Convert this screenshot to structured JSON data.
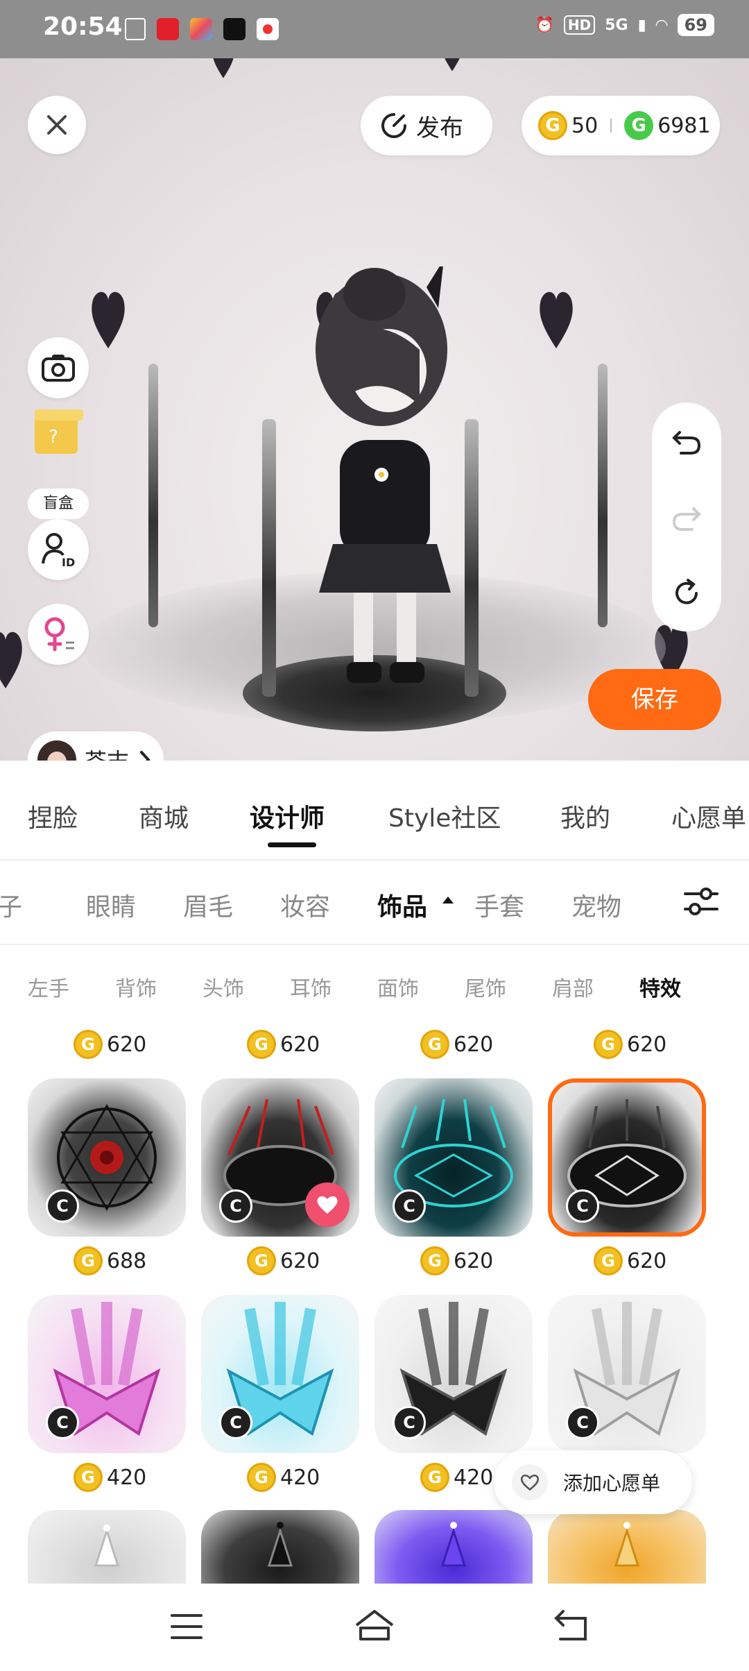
{
  "status_bar": {
    "time": "20:54",
    "hd_label": "HD",
    "network": "5G",
    "battery": "69"
  },
  "scene": {
    "close_icon": "close-icon",
    "publish_label": "发布",
    "coin_gold_amount": "50",
    "coin_green_amount": "6981",
    "blindbox_label": "盲盒",
    "user_name": "芥末",
    "save_label": "保存"
  },
  "tabs": [
    "捏脸",
    "商城",
    "设计师",
    "Style社区",
    "我的",
    "心愿单"
  ],
  "active_tab": "设计师",
  "categories": [
    "鞋子",
    "眼睛",
    "眉毛",
    "妆容",
    "饰品",
    "手套",
    "宠物"
  ],
  "active_category": "饰品",
  "subcategories": [
    "左手",
    "背饰",
    "头饰",
    "耳饰",
    "面饰",
    "尾饰",
    "肩部",
    "特效"
  ],
  "active_subcategory": "特效",
  "top_prices": [
    "620",
    "620",
    "620",
    "620"
  ],
  "items_row1": [
    {
      "price": "688",
      "theme": "red-eye-magic-circle"
    },
    {
      "price": "620",
      "theme": "red-spike-circle",
      "favorited": true
    },
    {
      "price": "620",
      "theme": "cyan-magic-circle"
    },
    {
      "price": "620",
      "theme": "black-white-magic-circle",
      "selected": true
    }
  ],
  "items_row2": [
    {
      "price": "420",
      "theme": "pink-star-beam"
    },
    {
      "price": "420",
      "theme": "cyan-star-beam"
    },
    {
      "price": "420",
      "theme": "black-star-beam"
    },
    {
      "price": "",
      "theme": "silver-star-beam"
    }
  ],
  "items_row3": [
    {
      "theme": "white-star"
    },
    {
      "theme": "black-star"
    },
    {
      "theme": "purple-star"
    },
    {
      "theme": "gold-star"
    }
  ],
  "wishlist_label": "添加心愿单",
  "colors": {
    "accent_orange": "#ff6a13",
    "gold_coin": "#f2c020",
    "green_coin": "#49c94a",
    "fav_pink": "#f0506e"
  }
}
